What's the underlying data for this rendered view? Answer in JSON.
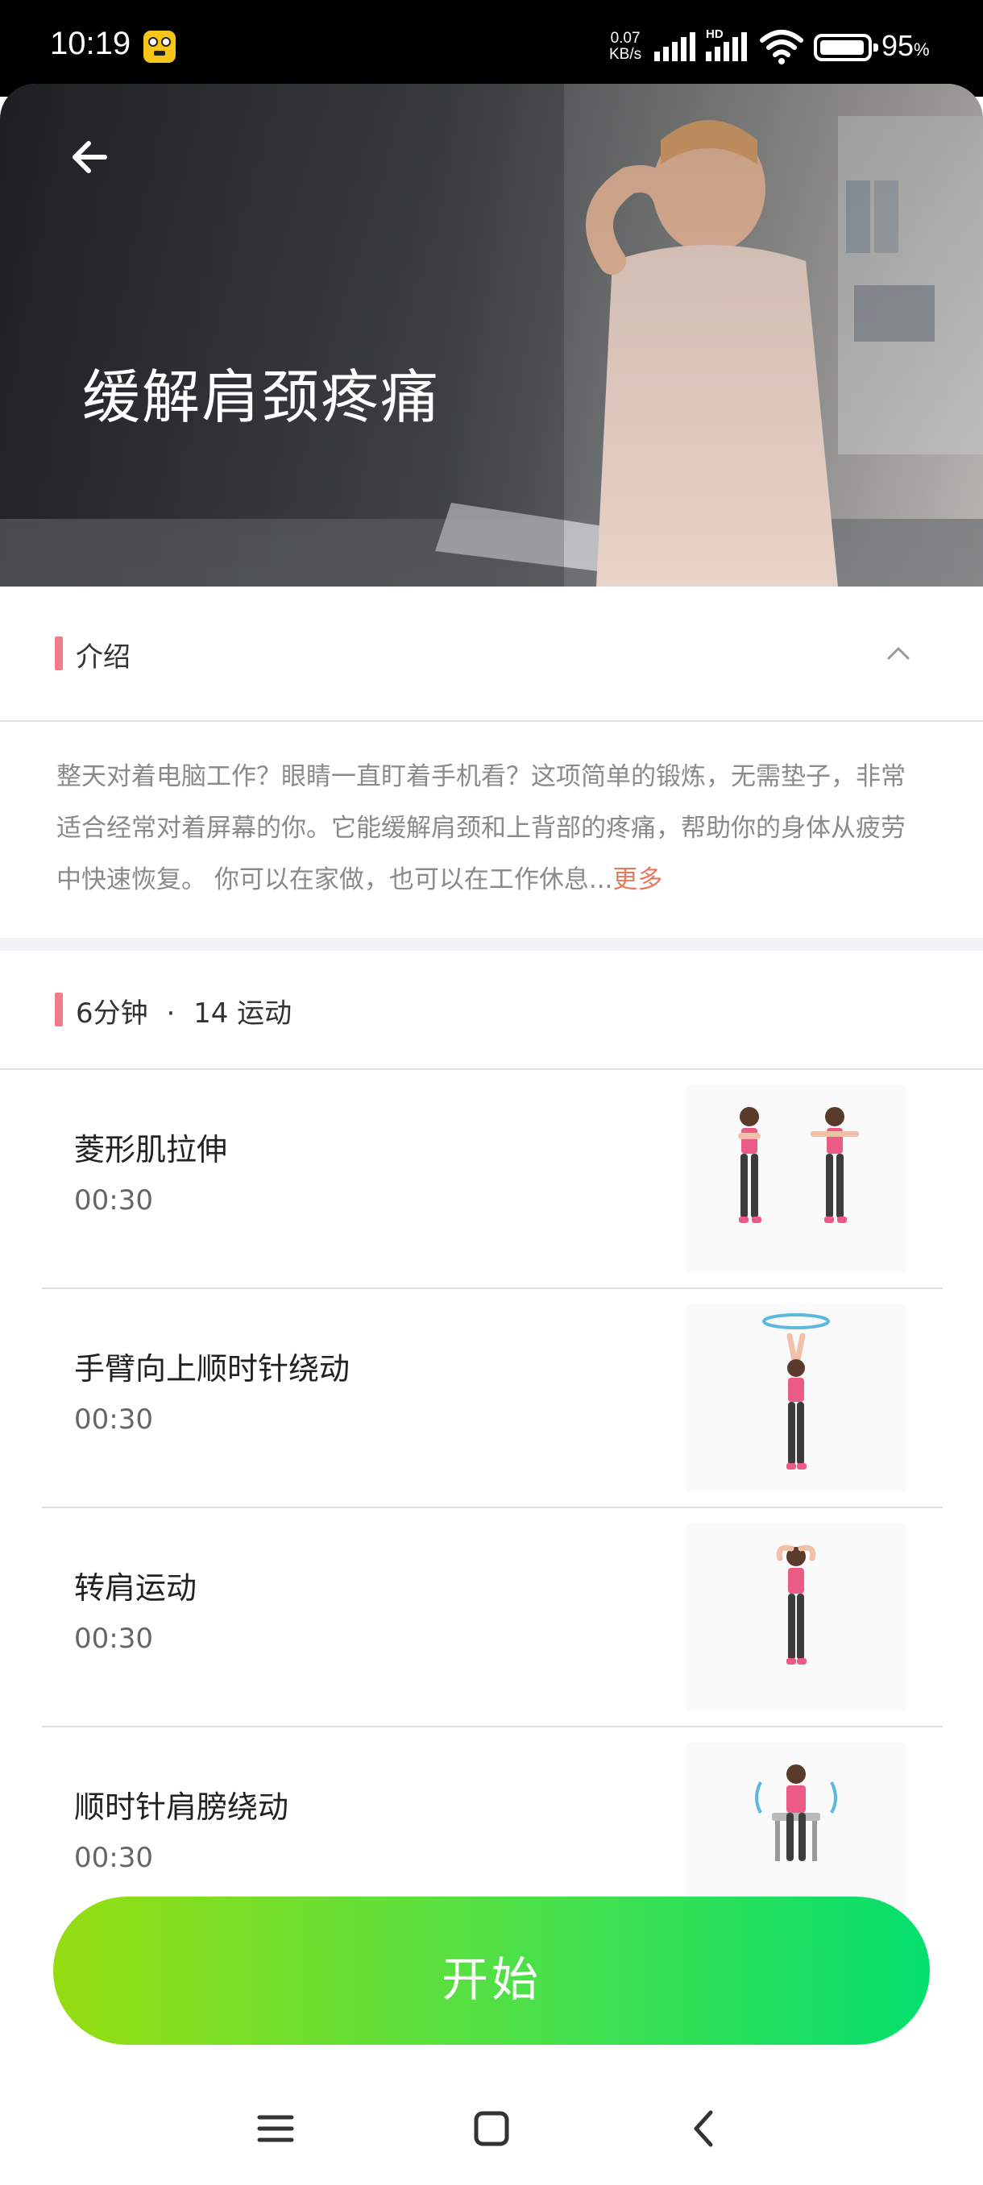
{
  "status_bar": {
    "time": "10:19",
    "net_speed_value": "0.07",
    "net_speed_unit": "KB/s",
    "hd_label": "HD",
    "battery": "95",
    "battery_unit": "%"
  },
  "hero": {
    "title": "缓解肩颈疼痛",
    "back_icon": "back-arrow-icon"
  },
  "intro": {
    "heading": "介绍",
    "text": "整天对着电脑工作？眼睛一直盯着手机看？这项简单的锻炼，无需垫子，非常适合经常对着屏幕的你。它能缓解肩颈和上背部的疼痛，帮助你的身体从疲劳中快速恢复。 你可以在家做，也可以在工作休息...",
    "more": "更多",
    "accent_color": "#f07b8a"
  },
  "workout": {
    "duration": "6分钟",
    "separator": "·",
    "count": "14 运动",
    "exercises": [
      {
        "name": "菱形肌拉伸",
        "time": "00:30"
      },
      {
        "name": "手臂向上顺时针绕动",
        "time": "00:30"
      },
      {
        "name": "转肩运动",
        "time": "00:30"
      },
      {
        "name": "顺时针肩膀绕动",
        "time": "00:30"
      }
    ]
  },
  "start_button": {
    "label": "开始",
    "gradient": [
      "#96dd10",
      "#04df6e"
    ]
  },
  "nav": {
    "icons": [
      "menu-icon",
      "home-square-icon",
      "back-chevron-icon"
    ]
  }
}
